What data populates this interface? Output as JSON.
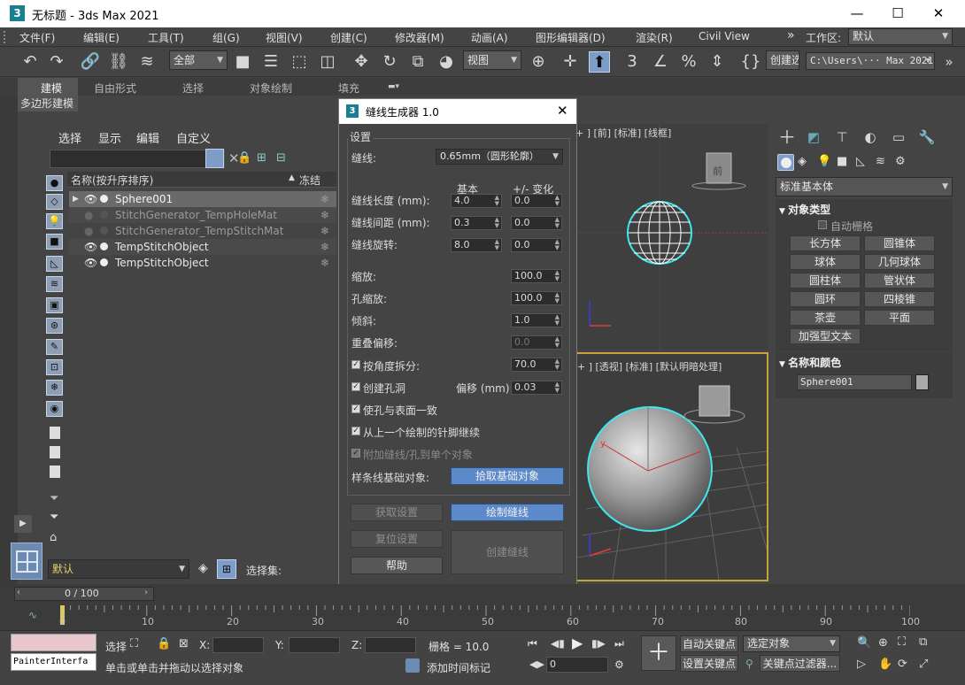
{
  "window": {
    "title": "无标题 - 3ds Max 2021",
    "minimize": "—",
    "maximize": "☐",
    "close": "✕"
  },
  "menu": {
    "items": [
      "文件(F)",
      "编辑(E)",
      "工具(T)",
      "组(G)",
      "视图(V)",
      "创建(C)",
      "修改器(M)",
      "动画(A)",
      "图形编辑器(D)",
      "渲染(R)",
      "Civil View"
    ],
    "more": "»",
    "workspace_label": "工作区:",
    "workspace_value": "默认"
  },
  "toolbar": {
    "selection_filter": "全部",
    "ref_coord": "视图",
    "create_selection_set": "创建选",
    "project_path": "C:\\Users\\··· Max 2021",
    "more": "»"
  },
  "ribbon": {
    "tabs": [
      "建模",
      "自由形式",
      "选择",
      "对象绘制",
      "填充"
    ],
    "subtab": "多边形建模"
  },
  "scene_explorer": {
    "menus": [
      "选择",
      "显示",
      "编辑",
      "自定义"
    ],
    "col_name": "名称(按升序排序)",
    "col_freeze": "冻结",
    "rows": [
      {
        "name": "Sphere001",
        "state": "selected"
      },
      {
        "name": "StitchGenerator_TempHoleMat",
        "state": "dim"
      },
      {
        "name": "StitchGenerator_TempStitchMat",
        "state": "dim"
      },
      {
        "name": "TempStitchObject",
        "state": "normal"
      },
      {
        "name": "TempStitchObject",
        "state": "normal"
      }
    ],
    "layer_value": "默认",
    "selection_set_label": "选择集:"
  },
  "dialog": {
    "title": "缝线生成器 1.0",
    "group_label": "设置",
    "stitch_label": "缝线:",
    "stitch_value": "0.65mm（圆形轮廓）",
    "col_base": "基本",
    "col_var": "+/- 变化",
    "length_label": "缝线长度 (mm):",
    "length_base": "4.0",
    "length_var": "0.0",
    "spacing_label": "缝线间距 (mm):",
    "spacing_base": "0.3",
    "spacing_var": "0.0",
    "rotation_label": "缝线旋转:",
    "rotation_base": "8.0",
    "rotation_var": "0.0",
    "scale_label": "缩放:",
    "scale_value": "100.0",
    "hole_scale_label": "孔缩放:",
    "hole_scale_value": "100.0",
    "tilt_label": "倾斜:",
    "tilt_value": "1.0",
    "overlap_label": "重叠偏移:",
    "overlap_value": "0.0",
    "split_label": "按角度拆分:",
    "split_value": "70.0",
    "create_holes_label": "创建孔洞",
    "offset_label": "偏移 (mm):",
    "offset_value": "0.03",
    "conform_label": "使孔与表面一致",
    "continue_label": "从上一个绘制的针脚继续",
    "attach_label": "附加缝线/孔到单个对象",
    "spline_label": "样条线基础对象:",
    "pick_button": "拾取基础对象",
    "get_settings": "获取设置",
    "draw_stitch": "绘制缝线",
    "reset_settings": "复位设置",
    "create_stitch": "创建缝线",
    "help": "帮助"
  },
  "viewports": {
    "top_label": "+ ] [前] [标准] [线框]",
    "persp_label": "+ ] [透视] [标准] [默认明暗处理]",
    "cube_label": "前"
  },
  "command_panel": {
    "category": "标准基本体",
    "object_type_title": "对象类型",
    "auto_grid": "自动栅格",
    "buttons": [
      "长方体",
      "圆锥体",
      "球体",
      "几何球体",
      "圆柱体",
      "管状体",
      "圆环",
      "四棱锥",
      "茶壶",
      "平面",
      "加强型文本"
    ],
    "name_color_title": "名称和颜色",
    "object_name": "Sphere001",
    "object_color": "#a8a8a8"
  },
  "timeline": {
    "frame_display": "0 / 100",
    "ticks": [
      "0",
      "10",
      "20",
      "30",
      "40",
      "50",
      "60",
      "70",
      "80",
      "90",
      "100"
    ]
  },
  "status": {
    "script_listener": "PainterInterfa",
    "select_label": "选择",
    "x_label": "X:",
    "y_label": "Y:",
    "z_label": "Z:",
    "grid_label": "栅格 = 10.0",
    "prompt": "单击或单击并拖动以选择对象",
    "add_time_tag": "添加时间标记",
    "auto_key": "自动关键点",
    "set_key": "设置关键点",
    "selected_object": "选定对象",
    "key_filters": "关键点过滤器...",
    "current_frame": "0"
  },
  "colors": {
    "selection_cyan": "#3fe6ef",
    "accent_blue": "#5b89c9",
    "viewport_border_active": "#c8a23a"
  }
}
